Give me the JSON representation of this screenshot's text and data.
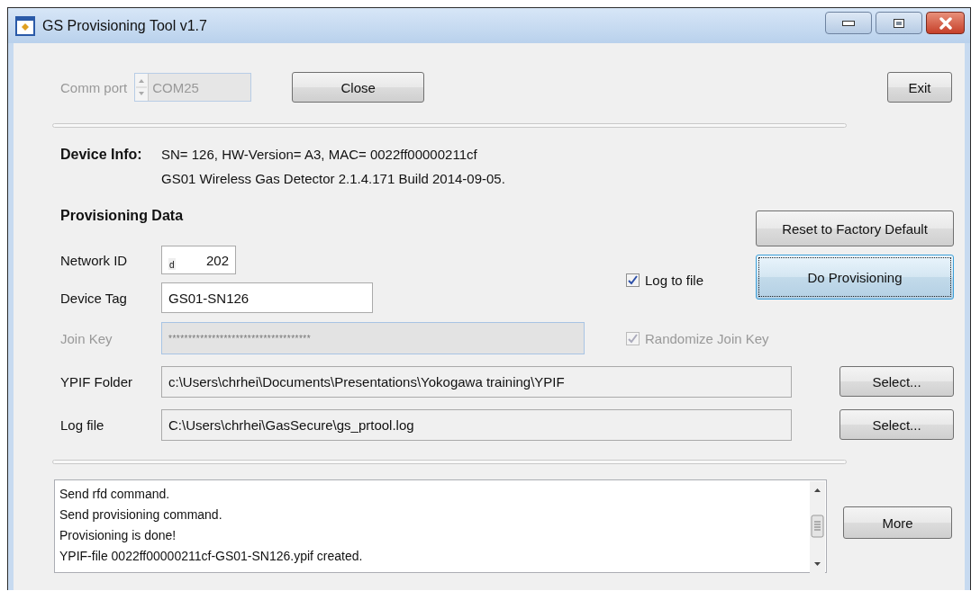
{
  "window": {
    "title": "GS Provisioning Tool v1.7"
  },
  "comm_port": {
    "label": "Comm port",
    "value": "COM25",
    "disabled": true
  },
  "close_button": {
    "label": "Close"
  },
  "exit_button": {
    "label": "Exit"
  },
  "device_info": {
    "label": "Device Info:",
    "lines": [
      "SN= 126, HW-Version= A3, MAC= 0022ff00000211cf",
      "GS01 Wireless Gas Detector 2.1.4.171 Build 2014-09-05."
    ]
  },
  "provisioning": {
    "heading": "Provisioning Data",
    "fields": [
      {
        "label": "Network ID",
        "kind": "number",
        "prefix": "d",
        "value": "202",
        "disabled": false
      },
      {
        "label": "Device Tag",
        "kind": "text",
        "value": "GS01-SN126",
        "disabled": false
      },
      {
        "label": "Join Key",
        "kind": "wide",
        "value": "************************************",
        "disabled": true
      }
    ]
  },
  "checkboxes": [
    {
      "label": "Log to file",
      "checked": true,
      "disabled": false
    },
    {
      "label": "Randomize Join Key",
      "checked": true,
      "disabled": true
    }
  ],
  "reset_button": {
    "label": "Reset to Factory Default",
    "focused": false
  },
  "provision_button": {
    "label": "Do Provisioning",
    "focused": true
  },
  "paths": [
    {
      "label": "YPIF Folder",
      "value": "c:\\Users\\chrhei\\Documents\\Presentations\\Yokogawa training\\YPIF",
      "button": "Select..."
    },
    {
      "label": "Log file",
      "value": "C:\\Users\\chrhei\\GasSecure\\gs_prtool.log",
      "button": "Select..."
    }
  ],
  "log": {
    "lines": [
      "Send rfd command.",
      "Send provisioning command.",
      "Provisioning is done!",
      "YPIF-file 0022ff00000211cf-GS01-SN126.ypif created."
    ]
  },
  "more_button": {
    "label": "More"
  }
}
